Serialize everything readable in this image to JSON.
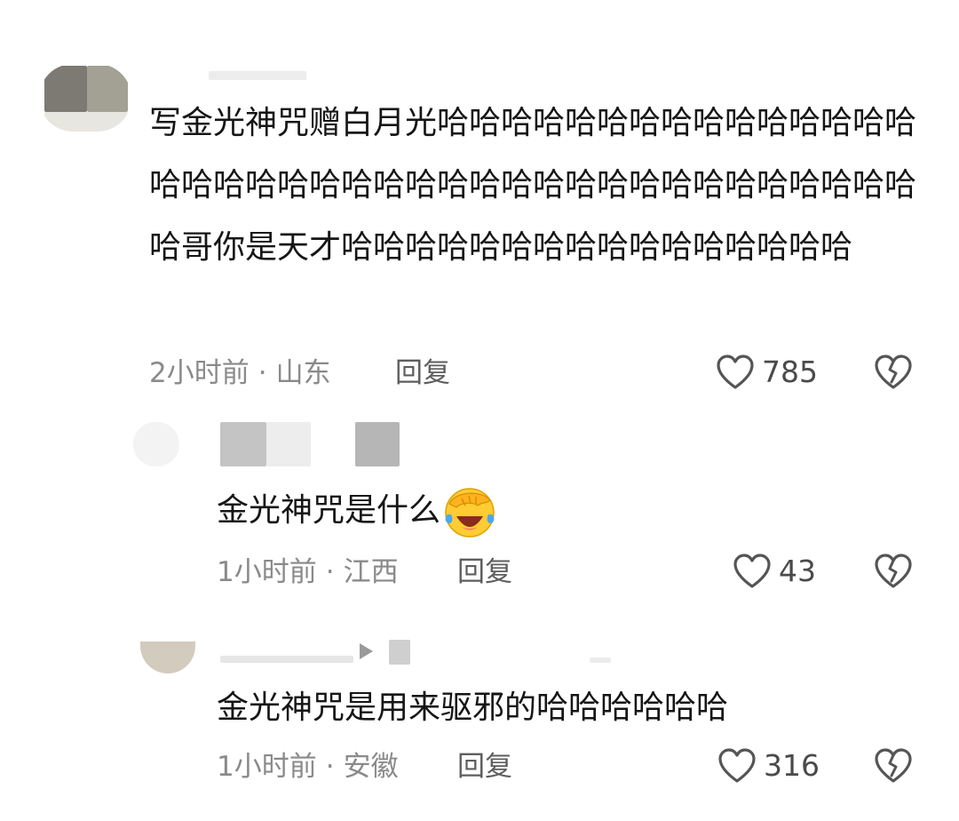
{
  "comments": [
    {
      "text": "写金光神咒赠白月光哈哈哈哈哈哈哈哈哈哈哈哈哈哈哈哈哈哈哈哈哈哈哈哈哈哈哈哈哈哈哈哈哈哈哈哈哈哈哈哈哥你是天才哈哈哈哈哈哈哈哈哈哈哈哈哈哈哈哈",
      "time": "2小时前",
      "location": "山东",
      "reply_label": "回复",
      "likes": "785"
    },
    {
      "text": "金光神咒是什么",
      "emoji": "facepalm-laugh-emoji",
      "time": "1小时前",
      "location": "江西",
      "reply_label": "回复",
      "likes": "43"
    },
    {
      "text": "金光神咒是用来驱邪的哈哈哈哈哈哈",
      "time": "1小时前",
      "location": "安徽",
      "reply_label": "回复",
      "likes": "316"
    }
  ],
  "icons": {
    "like": "heart-outline-icon",
    "dislike": "broken-heart-icon",
    "play": "play-triangle-icon"
  },
  "colors": {
    "text": "#161616",
    "meta": "#8a8a8a",
    "reply": "#5e5e5e",
    "icon": "#555555"
  }
}
